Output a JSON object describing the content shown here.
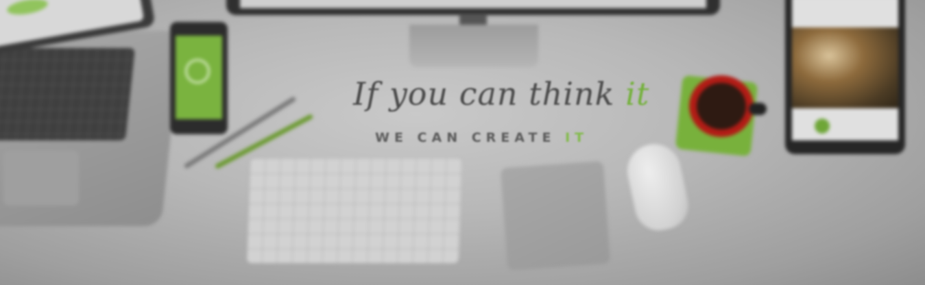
{
  "headline": {
    "script_text": "If you can think",
    "script_accent": "it",
    "caps_text": "WE CAN CREATE",
    "caps_accent": "IT"
  },
  "colors": {
    "accent_green": "#73b13a",
    "background_grey": "#b8b8b8",
    "cup_red": "#b21c16"
  }
}
